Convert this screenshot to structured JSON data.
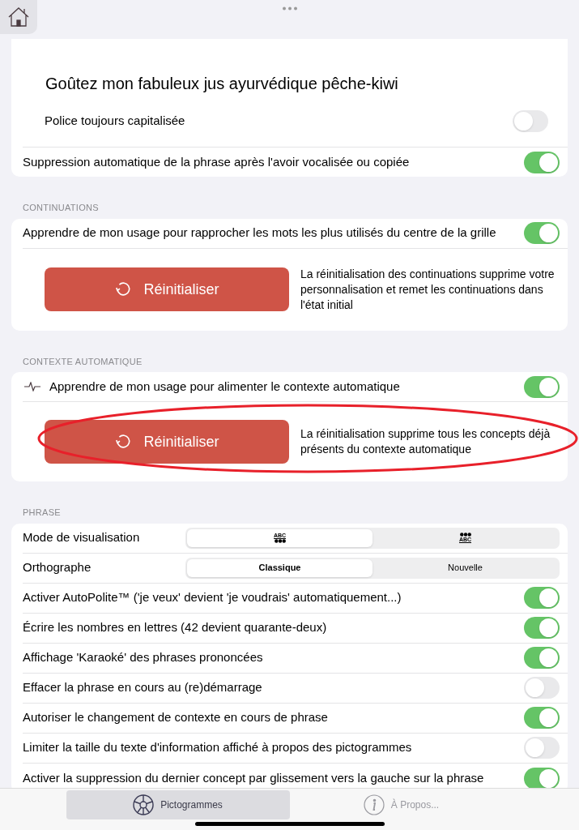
{
  "phrase_preview": {
    "text": "Goûtez mon fabuleux jus ayurvédique pêche-kiwi"
  },
  "display_rows": [
    {
      "kind": "inset",
      "label": "Police toujours capitalisée",
      "on": false
    },
    {
      "kind": "plain",
      "label": "Suppression automatique de la phrase après l'avoir vocalisée ou copiée",
      "on": true
    }
  ],
  "sections": [
    {
      "header": "CONTINUATIONS",
      "rows": [
        {
          "kind": "toggle",
          "label": "Apprendre de mon usage pour rapprocher les mots les plus utilisés du centre de la grille",
          "on": true
        }
      ],
      "reset": {
        "button": "Réinitialiser",
        "description": "La réinitialisation des continuations supprime votre personnalisation et remet les continuations dans l'état initial",
        "highlighted": false
      }
    },
    {
      "header": "CONTEXTE AUTOMATIQUE",
      "rows": [
        {
          "kind": "toggle-with-icon",
          "label": "Apprendre de mon usage pour alimenter le contexte automatique",
          "on": true
        }
      ],
      "reset": {
        "button": "Réinitialiser",
        "description": "La réinitialisation supprime tous les concepts déjà présents du contexte automatique",
        "highlighted": true
      }
    },
    {
      "header": "PHRASE",
      "rows": [
        {
          "kind": "segmented",
          "label": "Mode de visualisation",
          "segments": [
            {
              "kind": "abc-over-dots",
              "label": "ABC",
              "selected": true
            },
            {
              "kind": "dots-over-abc",
              "label": "ABC",
              "selected": false
            }
          ]
        },
        {
          "kind": "segmented",
          "label": "Orthographe",
          "segments": [
            {
              "kind": "text",
              "label": "Classique",
              "selected": true
            },
            {
              "kind": "text",
              "label": "Nouvelle",
              "selected": false
            }
          ]
        },
        {
          "kind": "toggle",
          "label": "Activer AutoPolite™ ('je veux' devient 'je voudrais' automatiquement...)",
          "on": true
        },
        {
          "kind": "toggle",
          "label": "Écrire les nombres en lettres (42 devient quarante-deux)",
          "on": true
        },
        {
          "kind": "toggle",
          "label": "Affichage 'Karaoké' des phrases prononcées",
          "on": true
        },
        {
          "kind": "toggle",
          "label": "Effacer la phrase en cours au (re)démarrage",
          "on": false
        },
        {
          "kind": "toggle",
          "label": "Autoriser le changement de contexte en cours de phrase",
          "on": true
        },
        {
          "kind": "toggle",
          "label": "Limiter la taille du texte d'information affiché à propos des pictogrammes",
          "on": false
        },
        {
          "kind": "toggle",
          "label": "Activer la suppression du dernier concept par glissement vers la gauche sur la phrase",
          "on": true
        }
      ]
    }
  ],
  "tab_bar": [
    {
      "kind": "wheel",
      "label": "Pictogrammes",
      "selected": true
    },
    {
      "kind": "info",
      "label": "À Propos...",
      "selected": false
    }
  ]
}
